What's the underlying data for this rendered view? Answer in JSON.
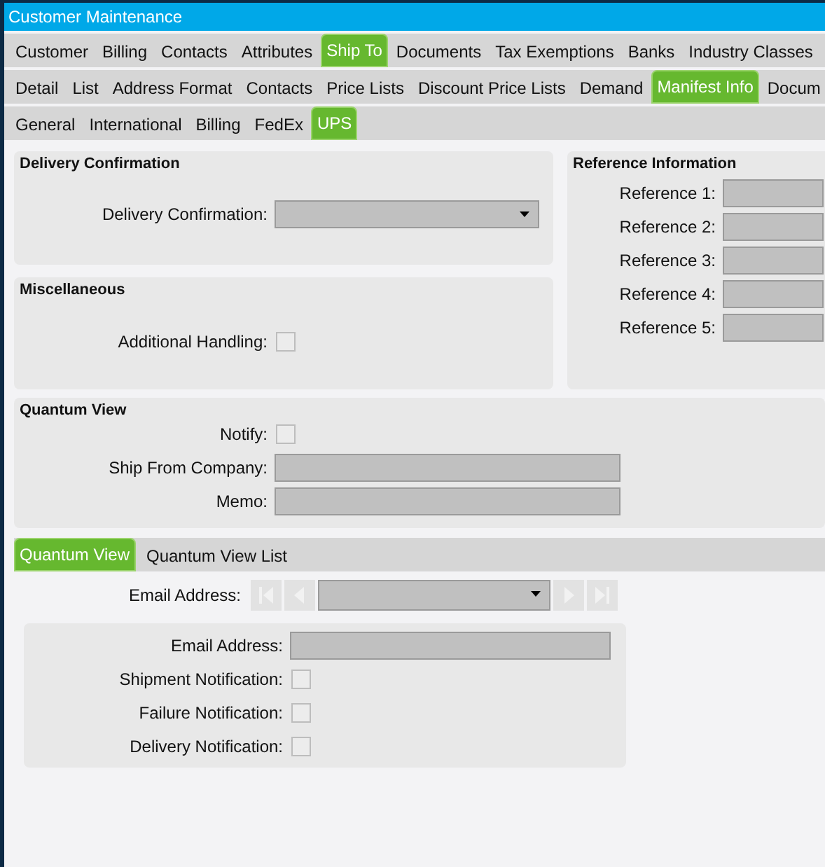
{
  "window": {
    "title": "Customer Maintenance"
  },
  "tab_rows": [
    [
      {
        "label": "Customer",
        "selected": false
      },
      {
        "label": "Billing",
        "selected": false
      },
      {
        "label": "Contacts",
        "selected": false
      },
      {
        "label": "Attributes",
        "selected": false
      },
      {
        "label": "Ship To",
        "selected": true
      },
      {
        "label": "Documents",
        "selected": false
      },
      {
        "label": "Tax Exemptions",
        "selected": false
      },
      {
        "label": "Banks",
        "selected": false
      },
      {
        "label": "Industry Classes",
        "selected": false
      }
    ],
    [
      {
        "label": "Detail",
        "selected": false
      },
      {
        "label": "List",
        "selected": false
      },
      {
        "label": "Address Format",
        "selected": false
      },
      {
        "label": "Contacts",
        "selected": false
      },
      {
        "label": "Price Lists",
        "selected": false
      },
      {
        "label": "Discount Price Lists",
        "selected": false
      },
      {
        "label": "Demand",
        "selected": false
      },
      {
        "label": "Manifest Info",
        "selected": true
      },
      {
        "label": "Docum",
        "selected": false
      }
    ],
    [
      {
        "label": "General",
        "selected": false
      },
      {
        "label": "International",
        "selected": false
      },
      {
        "label": "Billing",
        "selected": false
      },
      {
        "label": "FedEx",
        "selected": false
      },
      {
        "label": "UPS",
        "selected": true
      }
    ]
  ],
  "delivery_confirmation": {
    "title": "Delivery Confirmation",
    "fields": [
      {
        "label": "Delivery Confirmation:",
        "kind": "dropdown"
      }
    ]
  },
  "miscellaneous": {
    "title": "Miscellaneous",
    "fields": [
      {
        "label": "Additional Handling:",
        "kind": "checkbox",
        "checked": false
      }
    ]
  },
  "reference_information": {
    "title": "Reference Information",
    "fields": [
      {
        "label": "Reference 1:",
        "kind": "text"
      },
      {
        "label": "Reference 2:",
        "kind": "text"
      },
      {
        "label": "Reference 3:",
        "kind": "text"
      },
      {
        "label": "Reference 4:",
        "kind": "text"
      },
      {
        "label": "Reference 5:",
        "kind": "text"
      }
    ]
  },
  "quantum_view": {
    "title": "Quantum View",
    "fields": [
      {
        "label": "Notify:",
        "kind": "checkbox",
        "checked": false
      },
      {
        "label": "Ship From Company:",
        "kind": "text"
      },
      {
        "label": "Memo:",
        "kind": "text"
      }
    ]
  },
  "sub_tabs": [
    {
      "label": "Quantum View",
      "selected": true
    },
    {
      "label": "Quantum View List",
      "selected": false
    }
  ],
  "email_selector": {
    "label": "Email Address:",
    "nav_buttons": [
      {
        "kind": "first",
        "disabled": true
      },
      {
        "kind": "previous",
        "disabled": true
      },
      {
        "kind": "dropdown"
      },
      {
        "kind": "next",
        "disabled": true
      },
      {
        "kind": "last",
        "disabled": true
      }
    ]
  },
  "email_details": {
    "fields": [
      {
        "label": "Email Address:",
        "kind": "text"
      },
      {
        "label": "Shipment Notification:",
        "kind": "checkbox",
        "checked": false
      },
      {
        "label": "Failure Notification:",
        "kind": "checkbox",
        "checked": false
      },
      {
        "label": "Delivery Notification:",
        "kind": "checkbox",
        "checked": false
      }
    ]
  }
}
